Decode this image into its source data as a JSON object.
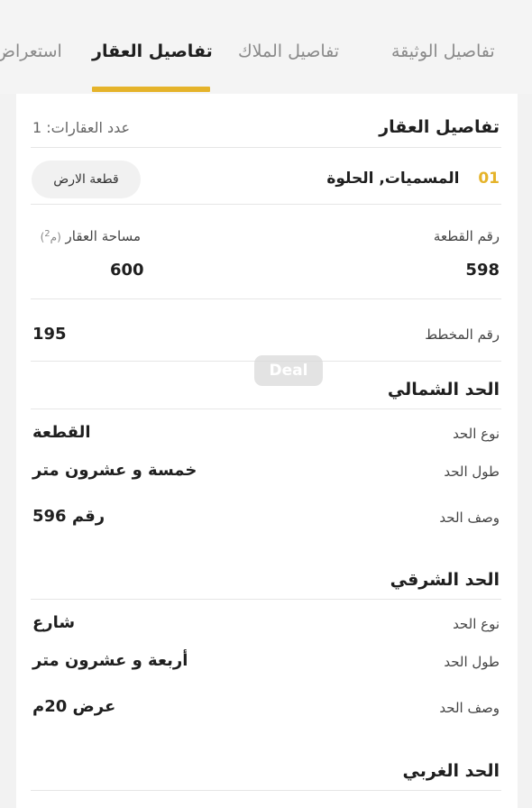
{
  "tabs": [
    {
      "label": "استعراض"
    },
    {
      "label": "تفاصيل العقار"
    },
    {
      "label": "تفاصيل الملاك"
    },
    {
      "label": "تفاصيل الوثيقة"
    }
  ],
  "card": {
    "title": "تفاصيل العقار",
    "count_label": "عدد العقارات: 1"
  },
  "property": {
    "index": "01",
    "name": "المسميات, الحلوة",
    "type_chip": "قطعة الارض",
    "plot_number_label": "رقم القطعة",
    "plot_number_value": "598",
    "area_label": "مساحة العقار",
    "area_unit_label": "(م",
    "area_unit_sup": "2",
    "area_unit_close": ")",
    "area_value": "600",
    "scheme_number_label": "رقم المخطط",
    "scheme_number_value": "195"
  },
  "watermark": "Deal",
  "north": {
    "title": "الحد الشمالي",
    "type_label": "نوع الحد",
    "type_value": "القطعة",
    "length_label": "طول الحد",
    "length_value": "خمسة و عشرون متر",
    "desc_label": "وصف الحد",
    "desc_value": "رقم 596"
  },
  "east": {
    "title": "الحد الشرقي",
    "type_label": "نوع الحد",
    "type_value": "شارع",
    "length_label": "طول الحد",
    "length_value": "أربعة و عشرون متر",
    "desc_label": "وصف الحد",
    "desc_value": "عرض 20م"
  },
  "west": {
    "title": "الحد الغربي"
  },
  "colors": {
    "accent": "#e5b32a",
    "background": "#f2f2f2",
    "card": "#ffffff"
  }
}
